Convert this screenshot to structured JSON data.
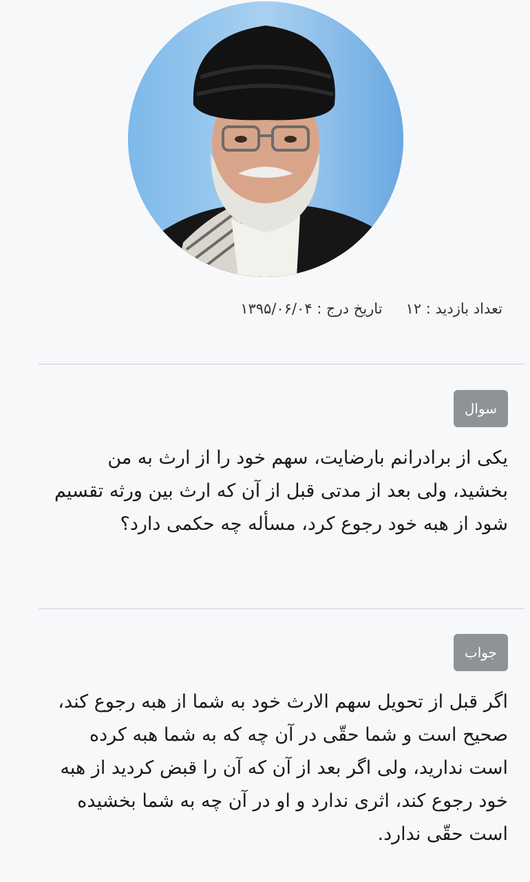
{
  "meta": {
    "visits": "تعداد بازدید : ۱۲",
    "date": "تاریخ درج : ۱۳۹۵/۰۶/۰۴"
  },
  "question": {
    "badge": "سوال",
    "text": "یکی از برادرانم بارضایت، سهم خود را از ارث به من بخشید، ولی بعد از مدتی قبل از آن که ارث بین ورثه تقسیم شود از هبه خود رجوع کرد، مسأله چه حکمی دارد؟"
  },
  "answer": {
    "badge": "جواب",
    "text": "اگر قبل از تحویل سهم الارث خود به شما از هبه رجوع کند، صحیح است و شما حقّی در آن چه که به شما هبه کرده است ندارید، ولی اگر بعد از آن که آن را قبض کردید از هبه خود رجوع کند، اثری ندارد و او در آن چه به شما بخشیده است حقّی ندارد."
  },
  "colors": {
    "badge_bg": "#8f9296",
    "divider": "#cfd1d6",
    "background": "#f7f8fa"
  }
}
